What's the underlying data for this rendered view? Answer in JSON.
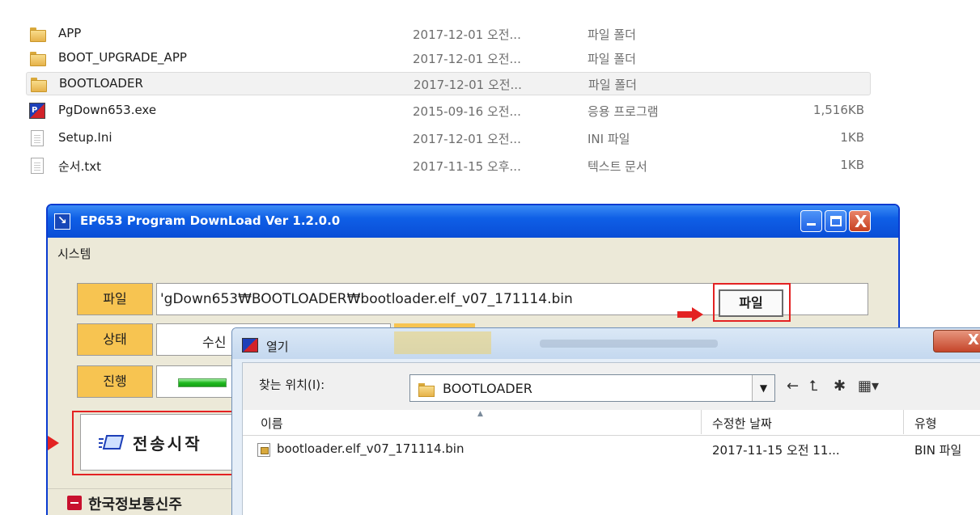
{
  "explorer": {
    "files": [
      {
        "name": "APP",
        "date": "2017-12-01 오전...",
        "type": "파일 폴더",
        "size": "",
        "icon": "folder-icon"
      },
      {
        "name": "BOOT_UPGRADE_APP",
        "date": "2017-12-01 오전...",
        "type": "파일 폴더",
        "size": "",
        "icon": "folder-icon"
      },
      {
        "name": "BOOTLOADER",
        "date": "2017-12-01 오전...",
        "type": "파일 폴더",
        "size": "",
        "icon": "folder-icon"
      },
      {
        "name": "PgDown653.exe",
        "date": "2015-09-16 오전...",
        "type": "응용 프로그램",
        "size": "1,516KB",
        "icon": "exe-icon"
      },
      {
        "name": "Setup.Ini",
        "date": "2017-12-01 오전...",
        "type": "INI 파일",
        "size": "1KB",
        "icon": "document-icon"
      },
      {
        "name": "순서.txt",
        "date": "2017-11-15 오후...",
        "type": "텍스트 문서",
        "size": "1KB",
        "icon": "document-icon"
      }
    ]
  },
  "app": {
    "title": "EP653 Program DownLoad Ver 1.2.0.0",
    "title_icon_glyph": "↘",
    "menu": {
      "system": "시스템"
    },
    "labels": {
      "file": "파일",
      "status": "상태",
      "progress": "진행"
    },
    "file_path": "'gDown653₩BOOTLOADER₩bootloader.elf_v07_171114.bin",
    "browse_label": "파일",
    "status_value": "수신",
    "start_label": "전송시작",
    "company": "한국정보통신주",
    "exe_glyph": "P"
  },
  "dialog": {
    "title": "열기",
    "close_glyph": "X",
    "look_in_label": "찾는 위치(I):",
    "look_in_value": "BOOTLOADER",
    "columns": {
      "name": "이름",
      "modified": "수정한 날짜",
      "type": "유형"
    },
    "files": [
      {
        "name": "bootloader.elf_v07_171114.bin",
        "modified": "2017-11-15 오전 11...",
        "type": "BIN 파일"
      }
    ],
    "toolbar_icons": [
      "back-icon",
      "up-folder-icon",
      "new-folder-icon",
      "view-menu-icon"
    ]
  },
  "colors": {
    "highlight": "#e32222",
    "label_fill": "#f7c451",
    "titlebar": "#0a4dd6"
  }
}
